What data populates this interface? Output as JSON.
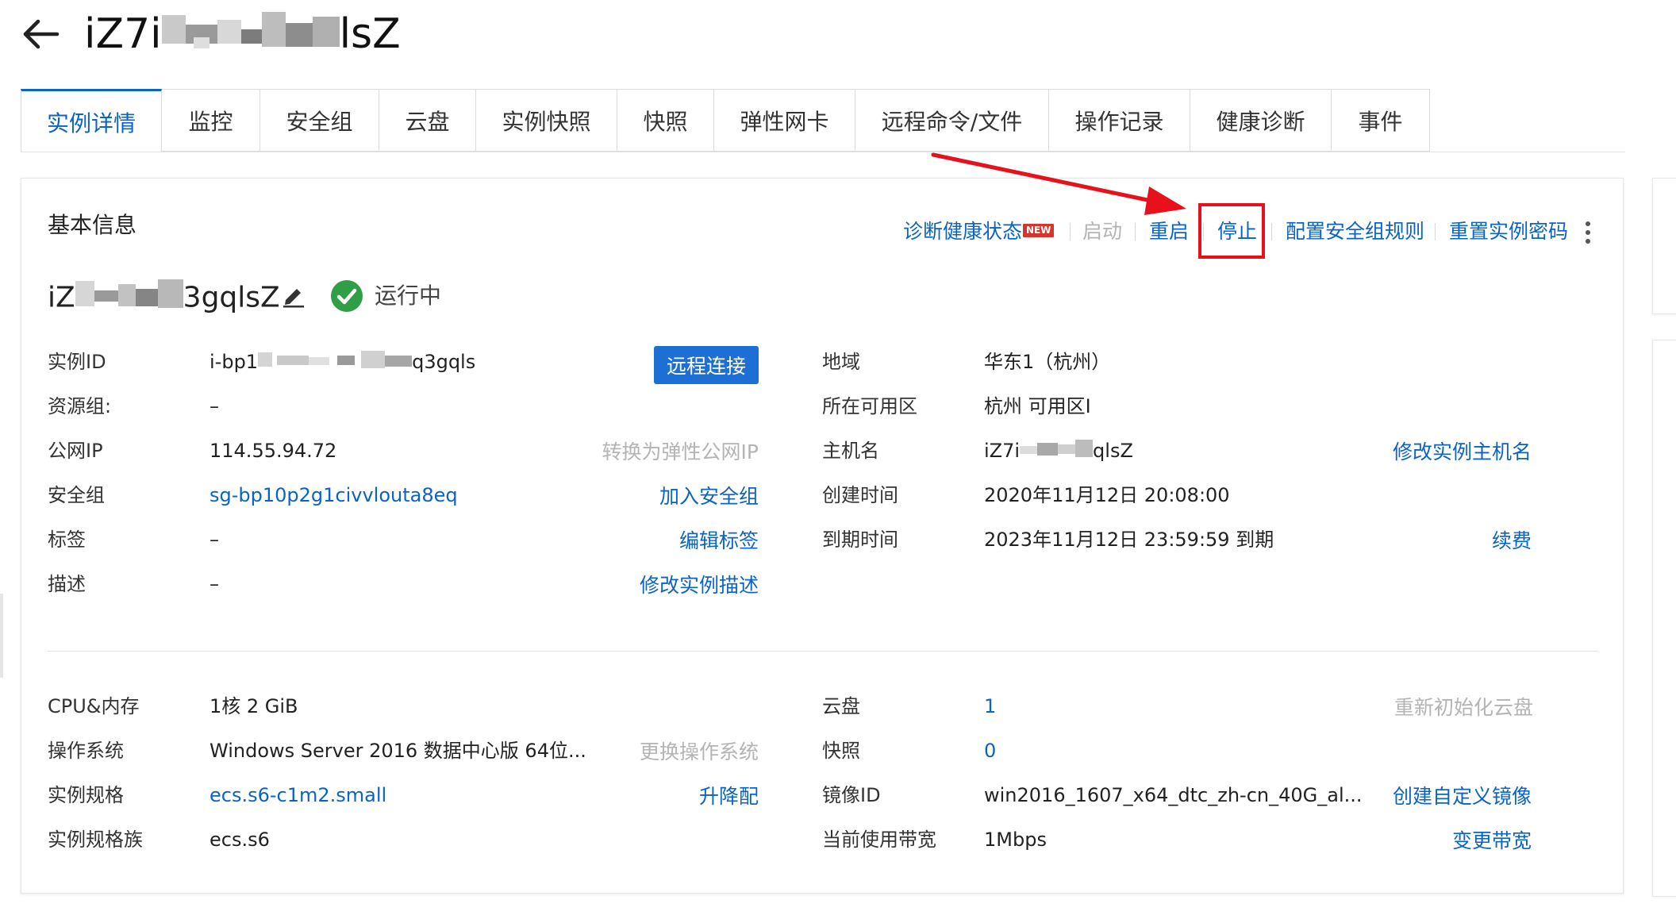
{
  "header": {
    "title_prefix": "iZ7i",
    "title_suffix": "lsZ"
  },
  "tabs": [
    {
      "label": "实例详情",
      "active": true
    },
    {
      "label": "监控"
    },
    {
      "label": "安全组"
    },
    {
      "label": "云盘"
    },
    {
      "label": "实例快照"
    },
    {
      "label": "快照"
    },
    {
      "label": "弹性网卡"
    },
    {
      "label": "远程命令/文件"
    },
    {
      "label": "操作记录"
    },
    {
      "label": "健康诊断"
    },
    {
      "label": "事件"
    }
  ],
  "basic_info": {
    "title": "基本信息",
    "actions": {
      "diagnose": "诊断健康状态",
      "new_badge": "NEW",
      "start": "启动",
      "restart": "重启",
      "stop": "停止",
      "config_sg_rules": "配置安全组规则",
      "reset_password": "重置实例密码"
    },
    "instance_name_prefix": "iZ",
    "instance_name_suffix": "3gqlsZ",
    "status": "运行中"
  },
  "left_fields": {
    "instance_id": {
      "label": "实例ID",
      "value_prefix": "i-bp1",
      "value_suffix": "q3gqls",
      "button": "远程连接"
    },
    "resource_group": {
      "label": "资源组:",
      "value": "–"
    },
    "public_ip": {
      "label": "公网IP",
      "value": "114.55.94.72",
      "action": "转换为弹性公网IP"
    },
    "security_group": {
      "label": "安全组",
      "value": "sg-bp10p2g1civvlouta8eq",
      "action": "加入安全组"
    },
    "tags": {
      "label": "标签",
      "value": "–",
      "action": "编辑标签"
    },
    "description": {
      "label": "描述",
      "value": "–",
      "action": "修改实例描述"
    }
  },
  "right_fields": {
    "region": {
      "label": "地域",
      "value": "华东1（杭州）"
    },
    "zone": {
      "label": "所在可用区",
      "value": "杭州 可用区I"
    },
    "hostname": {
      "label": "主机名",
      "value_prefix": "iZ7i",
      "value_suffix": "qlsZ",
      "action": "修改实例主机名"
    },
    "created": {
      "label": "创建时间",
      "value": "2020年11月12日 20:08:00"
    },
    "expires": {
      "label": "到期时间",
      "value": "2023年11月12日 23:59:59 到期",
      "action": "续费"
    }
  },
  "config_left": {
    "cpu_mem": {
      "label": "CPU&内存",
      "value": "1核 2 GiB"
    },
    "os": {
      "label": "操作系统",
      "value": "Windows Server 2016 数据中心版 64位...",
      "action": "更换操作系统"
    },
    "spec": {
      "label": "实例规格",
      "value": "ecs.s6-c1m2.small",
      "action": "升降配"
    },
    "spec_family": {
      "label": "实例规格族",
      "value": "ecs.s6"
    }
  },
  "config_right": {
    "disks": {
      "label": "云盘",
      "value": "1",
      "action": "重新初始化云盘"
    },
    "snapshots": {
      "label": "快照",
      "value": "0"
    },
    "image_id": {
      "label": "镜像ID",
      "value": "win2016_1607_x64_dtc_zh-cn_40G_al...",
      "action": "创建自定义镜像"
    },
    "bandwidth": {
      "label": "当前使用带宽",
      "value": "1Mbps",
      "action": "变更带宽"
    }
  },
  "colors": {
    "link": "#0b63c6",
    "primary_button": "#1d6fd4",
    "status_ok": "#2f9e44",
    "annotation_red": "#e8101a",
    "disabled": "#b4b4b4"
  }
}
